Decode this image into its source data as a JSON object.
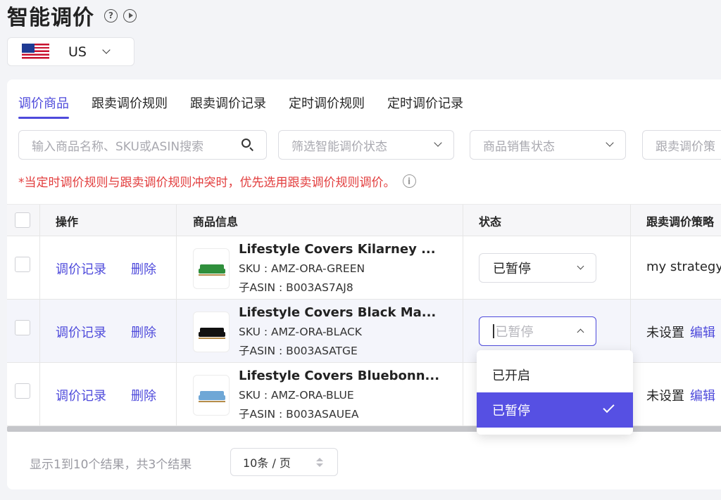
{
  "page": {
    "title": "智能调价"
  },
  "region": {
    "value": "US"
  },
  "tabs": [
    {
      "label": "调价商品",
      "active": true
    },
    {
      "label": "跟卖调价规则"
    },
    {
      "label": "跟卖调价记录"
    },
    {
      "label": "定时调价规则"
    },
    {
      "label": "定时调价记录"
    }
  ],
  "filters": {
    "search_placeholder": "输入商品名称、SKU或ASIN搜索",
    "status_placeholder": "筛选智能调价状态",
    "sale_placeholder": "商品销售状态",
    "strategy_placeholder": "跟卖调价策"
  },
  "notice": "*当定时调价规则与跟卖调价规则冲突时，优先选用跟卖调价规则调价。",
  "table": {
    "headers": {
      "action": "操作",
      "product": "商品信息",
      "status": "状态",
      "strategy": "跟卖调价策略"
    },
    "rows": [
      {
        "record": "调价记录",
        "delete": "删除",
        "name": "Lifestyle Covers Kilarney ...",
        "sku": "SKU : AMZ-ORA-GREEN",
        "asin": "子ASIN : B003AS7AJ8",
        "status": "已暂停",
        "strategy": "my strategy",
        "edit": "",
        "sofa_color": "#2f8f3c"
      },
      {
        "record": "调价记录",
        "delete": "删除",
        "name": "Lifestyle Covers Black Ma...",
        "sku": "SKU : AMZ-ORA-BLACK",
        "asin": "子ASIN : B003ASATGE",
        "status": "已暂停",
        "strategy": "未设置",
        "edit": "编辑",
        "sofa_color": "#111111"
      },
      {
        "record": "调价记录",
        "delete": "删除",
        "name": "Lifestyle Covers Bluebonn...",
        "sku": "SKU : AMZ-ORA-BLUE",
        "asin": "子ASIN : B003ASAUEA",
        "status": "",
        "strategy": "未设置",
        "edit": "编辑",
        "sofa_color": "#6fa7d6"
      }
    ]
  },
  "pagination": {
    "summary": "显示1到10个结果，共3个结果",
    "page_size": "10条 / 页"
  },
  "dropdown": {
    "options": [
      {
        "label": "已开启",
        "selected": false
      },
      {
        "label": "已暂停",
        "selected": true
      }
    ]
  },
  "icons": {
    "help": "question-circle-icon",
    "play": "play-circle-icon",
    "flag": "us-flag-icon",
    "search": "search-icon",
    "info": "info-circle-icon",
    "check": "check-icon"
  },
  "colors": {
    "accent": "#4e4adb",
    "notice": "#e23d3d",
    "selected_option_bg": "#5650e3"
  }
}
